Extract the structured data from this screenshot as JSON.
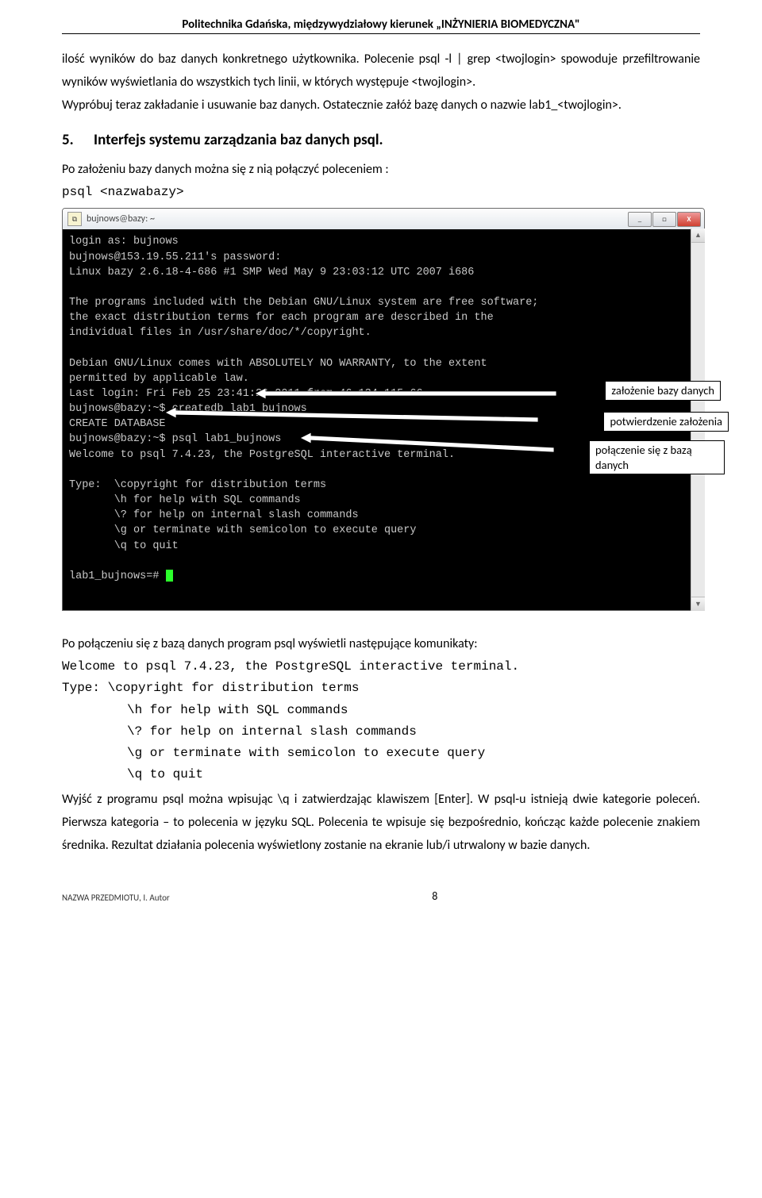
{
  "header": "Politechnika Gdańska, międzywydziałowy kierunek „INŻYNIERIA BIOMEDYCZNA\"",
  "p1": "ilość wyników do baz danych konkretnego użytkownika. Polecenie psql -l | grep <twojlogin> spowoduje przefiltrowanie wyników wyświetlania do wszystkich tych linii, w których występuje <twojlogin>.",
  "p2": "Wypróbuj teraz zakładanie i usuwanie baz danych. Ostatecznie załóż bazę danych o nazwie lab1_<twojlogin>.",
  "h2_num": "5.",
  "h2_txt": "Interfejs systemu zarządzania baz danych psql.",
  "p3": "Po założeniu bazy danych można się z nią połączyć poleceniem :",
  "cmd1": "psql <nazwabazy>",
  "win": {
    "title": "bujnows@bazy: ~",
    "min": "_",
    "max": "□",
    "close": "X",
    "sbup": "▲",
    "sbdn": "▼"
  },
  "term": "login as: bujnows\nbujnows@153.19.55.211's password:\nLinux bazy 2.6.18-4-686 #1 SMP Wed May 9 23:03:12 UTC 2007 i686\n\nThe programs included with the Debian GNU/Linux system are free software;\nthe exact distribution terms for each program are described in the\nindividual files in /usr/share/doc/*/copyright.\n\nDebian GNU/Linux comes with ABSOLUTELY NO WARRANTY, to the extent\npermitted by applicable law.\nLast login: Fri Feb 25 23:41:24 2011 from 46.134.115.66\nbujnows@bazy:~$ createdb lab1_bujnows\nCREATE DATABASE\nbujnows@bazy:~$ psql lab1_bujnows\nWelcome to psql 7.4.23, the PostgreSQL interactive terminal.\n\nType:  \\copyright for distribution terms\n       \\h for help with SQL commands\n       \\? for help on internal slash commands\n       \\g or terminate with semicolon to execute query\n       \\q to quit\n\nlab1_bujnows=#",
  "call1": "założenie bazy danych",
  "call2": "potwierdzenie założenia",
  "call3": "połączenie się z bazą danych",
  "p4": "Po połączeniu się z bazą danych program psql wyświetli następujące komunikaty:",
  "m1": "Welcome to psql 7.4.23, the PostgreSQL interactive terminal.",
  "m2": "Type:  \\copyright for distribution terms",
  "m3": "\\h for help with SQL commands",
  "m4": "\\? for help on internal slash commands",
  "m5": "\\g or terminate with semicolon to execute query",
  "m6": "\\q to quit",
  "p5": "Wyjść z programu psql można wpisując \\q i zatwierdzając klawiszem [Enter]. W psql-u istnieją dwie kategorie poleceń. Pierwsza kategoria – to polecenia w języku SQL. Polecenia te wpisuje się bezpośrednio, kończąc każde polecenie znakiem średnika. Rezultat działania polecenia wyświetlony zostanie na ekranie lub/i utrwalony w bazie danych.",
  "footer_attr": "NAZWA PRZEDMIOTU, I. Autor",
  "page_num": "8"
}
